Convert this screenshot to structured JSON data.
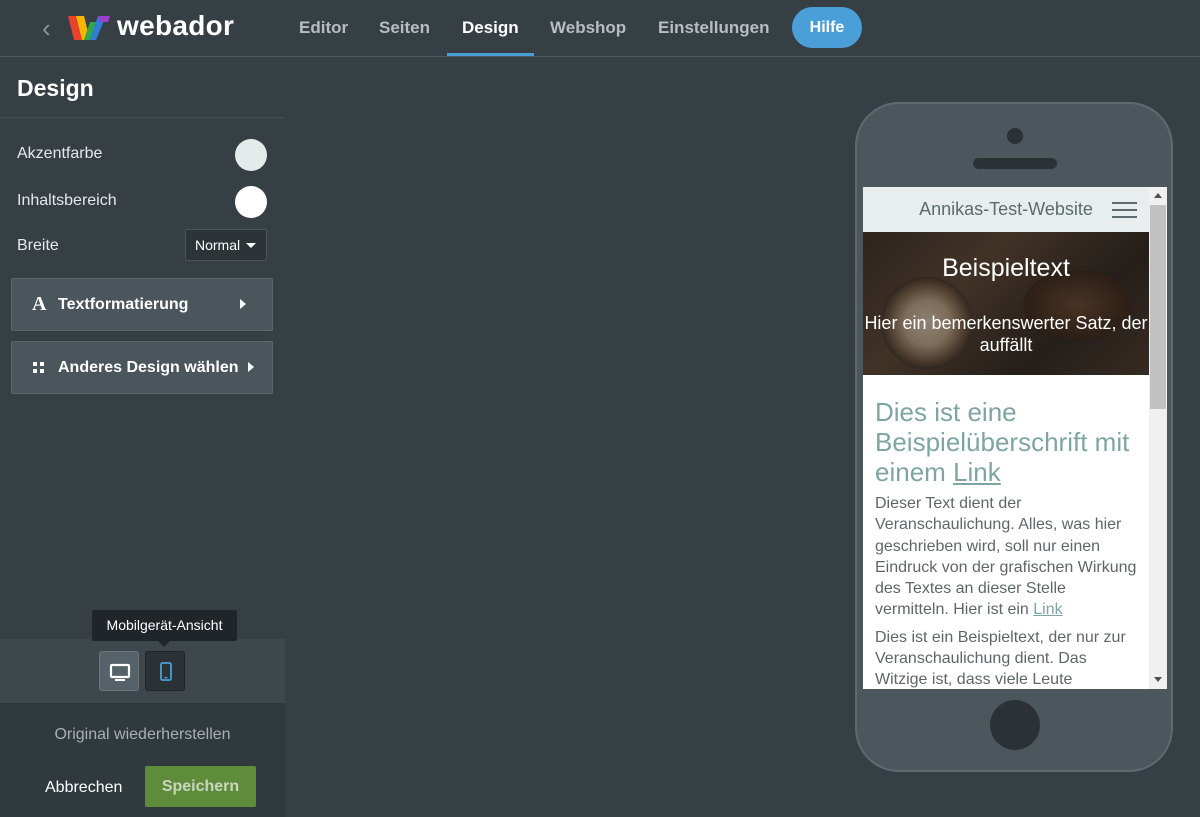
{
  "app": {
    "logo_text": "webador"
  },
  "nav": {
    "items": [
      {
        "label": "Editor"
      },
      {
        "label": "Seiten"
      },
      {
        "label": "Design"
      },
      {
        "label": "Webshop"
      },
      {
        "label": "Einstellungen"
      }
    ],
    "active": "Design",
    "help_label": "Hilfe"
  },
  "sidebar": {
    "title": "Design",
    "accent_label": "Akzentfarbe",
    "accent_color": "#e5ebea",
    "content_label": "Inhaltsbereich",
    "content_color": "#ffffff",
    "width_label": "Breite",
    "width_value": "Normal",
    "text_format_label": "Textformatierung",
    "other_design_label": "Anderes Design wählen",
    "tooltip": "Mobilgerät-Ansicht",
    "restore_label": "Original wiederherstellen",
    "cancel_label": "Abbrechen",
    "save_label": "Speichern"
  },
  "preview": {
    "site_name": "Annikas-Test-Website",
    "hero_title": "Beispieltext",
    "hero_subtitle": "Hier ein bemerkenswerter Satz, der auffällt",
    "heading_text": "Dies ist eine Beispielüberschrift mit einem",
    "heading_link": "Link",
    "paragraph1_text": "Dieser Text dient der Veranschaulichung. Alles, was hier geschrieben wird, soll nur einen Eindruck von der grafischen Wirkung des Textes an dieser Stelle vermitteln. Hier ist ein",
    "paragraph1_link": "Link",
    "paragraph2_text": "Dies ist ein Beispieltext, der nur zur Veranschaulichung dient. Das Witzige ist, dass viele Leute"
  },
  "colors": {
    "accent_blue": "#4a9fd8",
    "save_green": "#5f8c3a",
    "preview_teal": "#7fa5a2"
  }
}
